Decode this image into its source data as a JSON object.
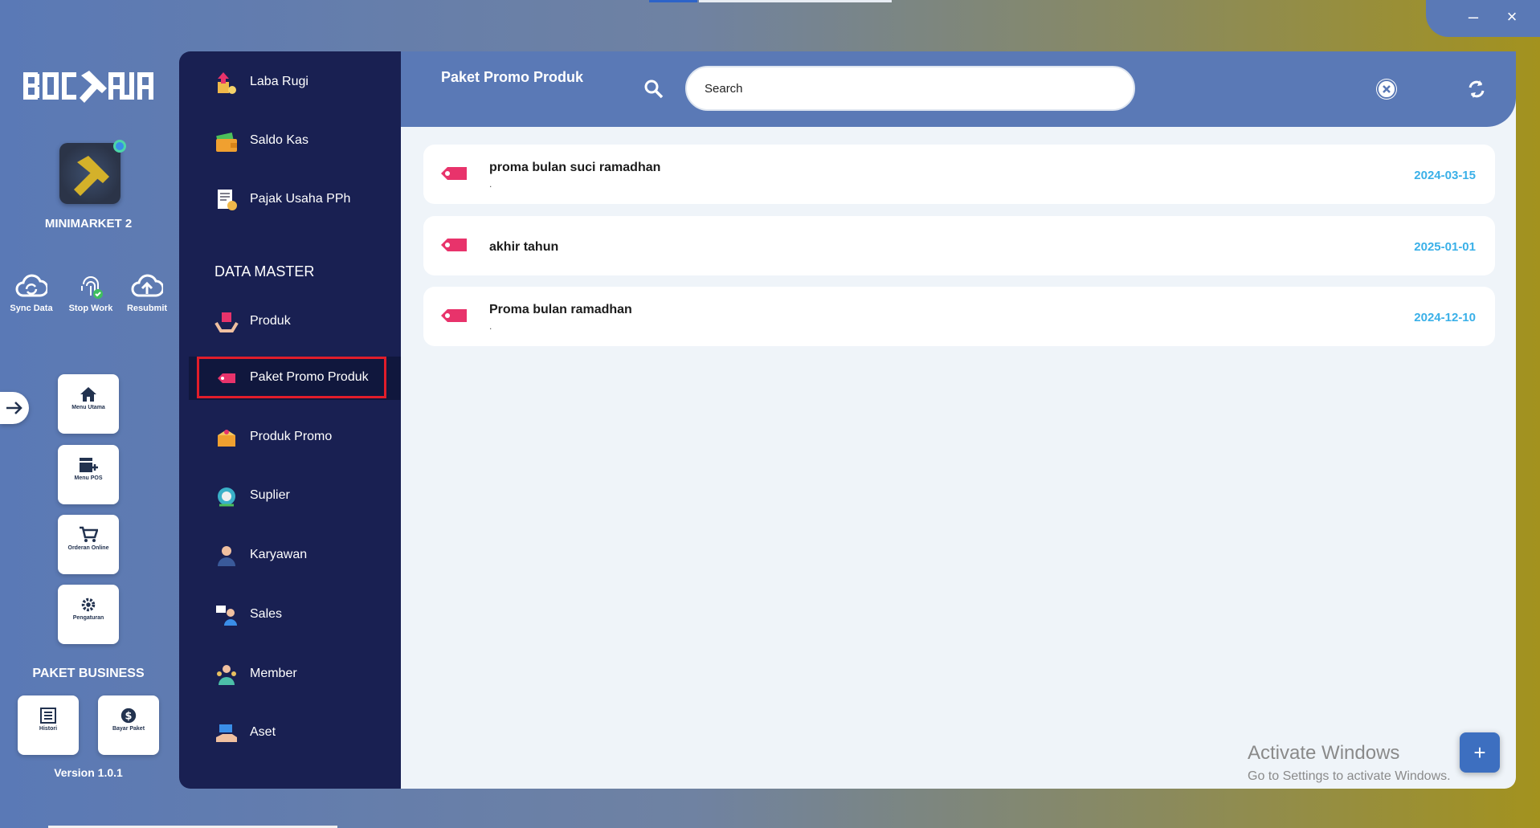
{
  "window": {
    "minimize_label": "–",
    "close_label": "×"
  },
  "brand": {
    "logo_text": "BOC AJA"
  },
  "store": {
    "name": "MINIMARKET 2"
  },
  "quick_actions": [
    {
      "label": "Sync Data",
      "icon": "sync-cloud-icon"
    },
    {
      "label": "Stop Work",
      "icon": "fingerprint-icon"
    },
    {
      "label": "Resubmit",
      "icon": "upload-cloud-icon"
    }
  ],
  "nav_tiles": [
    {
      "label": "Menu Utama",
      "icon": "home-icon"
    },
    {
      "label": "Menu POS",
      "icon": "store-add-icon"
    },
    {
      "label": "Orderan Online",
      "icon": "cart-icon"
    },
    {
      "label": "Pengaturan",
      "icon": "gear-icon"
    }
  ],
  "package": {
    "title": "PAKET BUSINESS",
    "buttons": [
      {
        "label": "Histori",
        "icon": "list-icon"
      },
      {
        "label": "Bayar Paket",
        "icon": "dollar-icon"
      }
    ],
    "version": "Version 1.0.1"
  },
  "menu": {
    "section_title": "DATA MASTER",
    "items_top": [
      {
        "label": "Laba Rugi",
        "icon": "profit-loss-icon"
      },
      {
        "label": "Saldo Kas",
        "icon": "wallet-icon"
      },
      {
        "label": "Pajak Usaha PPh",
        "icon": "tax-document-icon"
      }
    ],
    "items_master": [
      {
        "label": "Produk",
        "icon": "product-hand-icon"
      },
      {
        "label": "Paket Promo Produk",
        "icon": "promo-tag-icon",
        "active": true
      },
      {
        "label": "Produk Promo",
        "icon": "promo-box-icon"
      },
      {
        "label": "Suplier",
        "icon": "supplier-icon"
      },
      {
        "label": "Karyawan",
        "icon": "employee-icon"
      },
      {
        "label": "Sales",
        "icon": "sales-icon"
      },
      {
        "label": "Member",
        "icon": "member-icon"
      },
      {
        "label": "Aset",
        "icon": "asset-icon"
      }
    ]
  },
  "main": {
    "title": "Paket Promo Produk",
    "search": {
      "placeholder": "Search",
      "value": ""
    },
    "promos": [
      {
        "name": "proma bulan suci ramadhan",
        "description": ".",
        "date": "2024-03-15"
      },
      {
        "name": "akhir tahun",
        "description": "",
        "date": "2025-01-01"
      },
      {
        "name": "Proma bulan ramadhan",
        "description": ".",
        "date": "2024-12-10"
      }
    ],
    "add_button_label": "+"
  },
  "watermark": {
    "line1": "Activate Windows",
    "line2": "Go to Settings to activate Windows."
  },
  "colors": {
    "sidebar_dark": "#192052",
    "header_blue": "#5a79b6",
    "date_blue": "#3ab0e8",
    "promo_tag": "#e8336b",
    "highlight_red": "#e11d2a"
  }
}
